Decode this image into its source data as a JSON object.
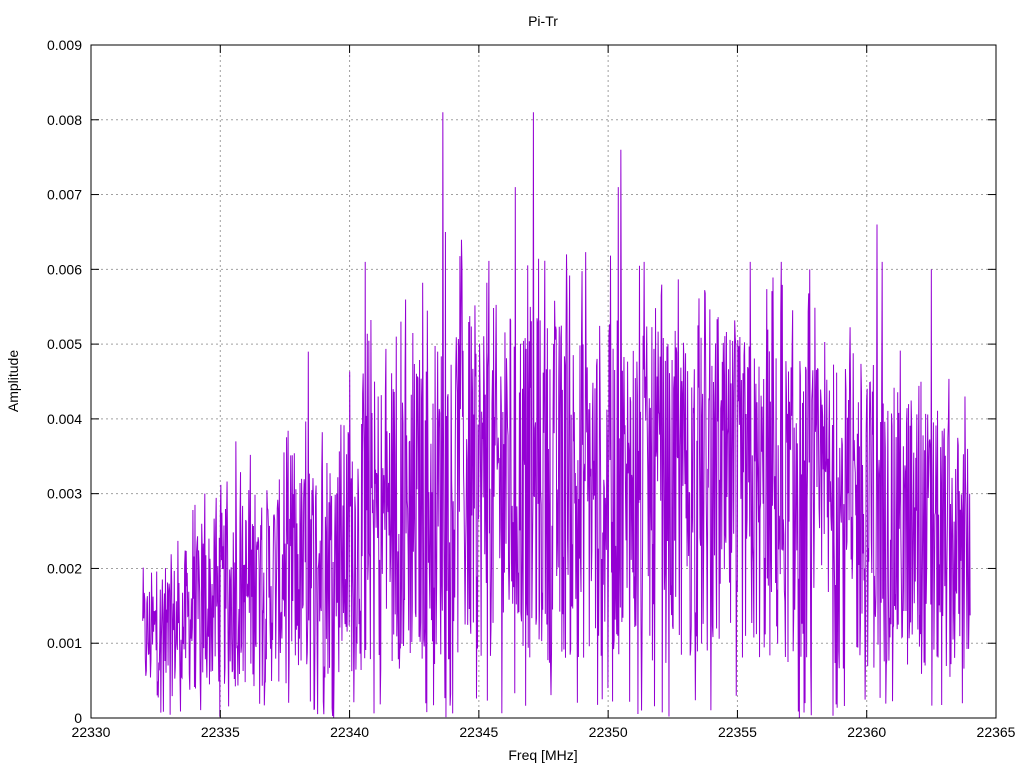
{
  "chart_data": {
    "type": "line",
    "title": "Pi-Tr",
    "xlabel": "Freq [MHz]",
    "ylabel": "Amplitude",
    "xlim": [
      22330,
      22365
    ],
    "ylim": [
      0,
      0.009
    ],
    "x_ticks": [
      "22330",
      "22335",
      "22340",
      "22345",
      "22350",
      "22355",
      "22360",
      "22365"
    ],
    "y_ticks": [
      "0",
      "0.001",
      "0.002",
      "0.003",
      "0.004",
      "0.005",
      "0.006",
      "0.007",
      "0.008",
      "0.009"
    ],
    "grid": true,
    "line_color": "#9400d3",
    "series": [
      {
        "x_start": 22332.0,
        "x_end": 22364.0,
        "envelope_x": [
          22332.0,
          22333.0,
          22334.0,
          22335.0,
          22336.0,
          22337.0,
          22338.0,
          22339.0,
          22340.0,
          22341.0,
          22342.0,
          22343.0,
          22344.0,
          22345.0,
          22346.0,
          22347.0,
          22348.0,
          22349.0,
          22350.0,
          22351.0,
          22352.0,
          22353.0,
          22354.0,
          22355.0,
          22356.0,
          22357.0,
          22358.0,
          22359.0,
          22360.0,
          22361.0,
          22362.0,
          22363.0,
          22364.0
        ],
        "envelope_y": [
          0.001,
          0.0011,
          0.0013,
          0.0015,
          0.0016,
          0.0017,
          0.0018,
          0.002,
          0.0022,
          0.0025,
          0.0026,
          0.0027,
          0.0029,
          0.003,
          0.003,
          0.003,
          0.0029,
          0.0029,
          0.0029,
          0.0029,
          0.0028,
          0.0028,
          0.0028,
          0.0028,
          0.0027,
          0.0027,
          0.0026,
          0.0026,
          0.0025,
          0.0024,
          0.0023,
          0.0022,
          0.002
        ],
        "peaks": [
          {
            "x": 22334.4,
            "y": 0.003
          },
          {
            "x": 22335.6,
            "y": 0.0037
          },
          {
            "x": 22338.4,
            "y": 0.0049
          },
          {
            "x": 22340.6,
            "y": 0.0061
          },
          {
            "x": 22341.8,
            "y": 0.0051
          },
          {
            "x": 22343.6,
            "y": 0.0081
          },
          {
            "x": 22343.7,
            "y": 0.0065
          },
          {
            "x": 22346.4,
            "y": 0.0071
          },
          {
            "x": 22347.1,
            "y": 0.0081
          },
          {
            "x": 22348.4,
            "y": 0.0062
          },
          {
            "x": 22350.5,
            "y": 0.0076
          },
          {
            "x": 22350.4,
            "y": 0.0071
          },
          {
            "x": 22351.4,
            "y": 0.0061
          },
          {
            "x": 22355.5,
            "y": 0.0061
          },
          {
            "x": 22356.7,
            "y": 0.0061
          },
          {
            "x": 22357.8,
            "y": 0.006
          },
          {
            "x": 22360.4,
            "y": 0.0066
          },
          {
            "x": 22360.6,
            "y": 0.0061
          },
          {
            "x": 22362.5,
            "y": 0.006
          },
          {
            "x": 22363.8,
            "y": 0.0043
          }
        ],
        "troughs": [
          {
            "x": 22339.0,
            "y": 5e-05
          },
          {
            "x": 22350.0,
            "y": 0.0004
          },
          {
            "x": 22351.3,
            "y": 0.0001
          },
          {
            "x": 22357.4,
            "y": 0.0
          }
        ]
      }
    ]
  }
}
